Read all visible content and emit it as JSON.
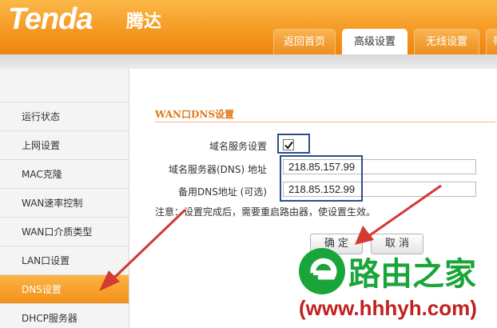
{
  "header": {
    "brand": "Tenda",
    "brand_cn": "腾达",
    "tabs": [
      {
        "label": "返回首页"
      },
      {
        "label": "高级设置"
      },
      {
        "label": "无线设置"
      },
      {
        "label": "带"
      }
    ]
  },
  "sidebar": {
    "items": [
      {
        "label": "运行状态"
      },
      {
        "label": "上网设置"
      },
      {
        "label": "MAC克隆"
      },
      {
        "label": "WAN速率控制"
      },
      {
        "label": "WAN口介质类型"
      },
      {
        "label": "LAN口设置"
      },
      {
        "label": "DNS设置"
      },
      {
        "label": "DHCP服务器"
      }
    ]
  },
  "main": {
    "section_title": "WAN口DNS设置",
    "dns_service_label": "域名服务设置",
    "dns_service_checked": true,
    "primary_dns_label": "域名服务器(DNS) 地址",
    "primary_dns_value": "218.85.157.99",
    "secondary_dns_label": "备用DNS地址 (可选)",
    "secondary_dns_value": "218.85.152.99",
    "note": "注意：设置完成后，需要重启路由器，使设置生效。",
    "confirm_label": "确 定",
    "cancel_label": "取 消"
  },
  "watermark": {
    "site_name": "路由之家",
    "url": "(www.hhhyh.com)"
  },
  "colors": {
    "header_orange": "#f59a23",
    "active_orange": "#f39119",
    "section_title": "#e0781a",
    "highlight_box": "#2e4f86",
    "arrow_red": "#d23a32",
    "watermark_green": "#1aa53a",
    "watermark_red": "#c0201e"
  }
}
